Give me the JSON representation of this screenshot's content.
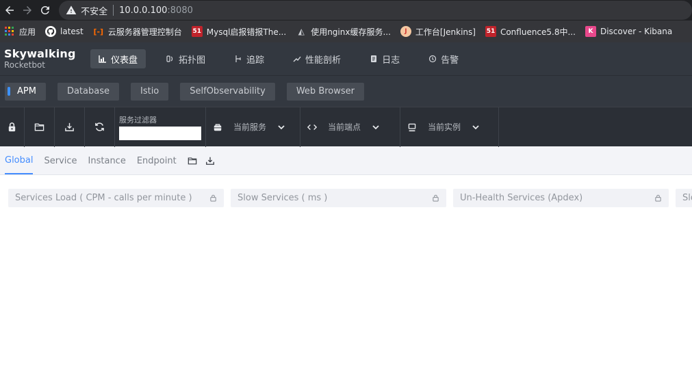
{
  "browser": {
    "insecure_label": "不安全",
    "host": "10.0.0.100",
    "port": ":8080"
  },
  "bookmarks": [
    {
      "label": "应用",
      "icon": "apps-grid-icon",
      "color": "#f28b82"
    },
    {
      "label": "latest",
      "icon": "github-icon",
      "color": "#ffffff"
    },
    {
      "label": "云服务器管理控制台",
      "icon": "aliyun-icon",
      "color": "#ff6a00"
    },
    {
      "label": "Mysql启报错报The...",
      "icon": "51cto-icon",
      "color": "#c0232b"
    },
    {
      "label": "使用nginx缓存服务...",
      "icon": "site-icon",
      "color": "#9aa0a6"
    },
    {
      "label": "工作台[Jenkins]",
      "icon": "jenkins-icon",
      "color": "#d33833"
    },
    {
      "label": "Confluence5.8中...",
      "icon": "51cto-icon",
      "color": "#c0232b"
    },
    {
      "label": "Discover - Kibana",
      "icon": "kibana-icon",
      "color": "#e8488b"
    }
  ],
  "header": {
    "logo_line1": "Skywalking",
    "logo_line2": "Rocketbot",
    "menu": [
      {
        "label": "仪表盘",
        "icon": "dashboard-icon",
        "active": true
      },
      {
        "label": "拓扑图",
        "icon": "topology-icon",
        "active": false
      },
      {
        "label": "追踪",
        "icon": "trace-icon",
        "active": false
      },
      {
        "label": "性能剖析",
        "icon": "profile-icon",
        "active": false
      },
      {
        "label": "日志",
        "icon": "log-icon",
        "active": false
      },
      {
        "label": "告警",
        "icon": "alarm-icon",
        "active": false
      }
    ]
  },
  "layers": [
    {
      "label": "APM",
      "active": true
    },
    {
      "label": "Database",
      "active": false
    },
    {
      "label": "Istio",
      "active": false
    },
    {
      "label": "SelfObservability",
      "active": false
    },
    {
      "label": "Web Browser",
      "active": false
    }
  ],
  "toolbar": {
    "filter_label": "服务过滤器",
    "filter_value": "",
    "current_service": "当前服务",
    "current_endpoint": "当前端点",
    "current_instance": "当前实例"
  },
  "tabs": [
    {
      "label": "Global",
      "active": true
    },
    {
      "label": "Service",
      "active": false
    },
    {
      "label": "Instance",
      "active": false
    },
    {
      "label": "Endpoint",
      "active": false
    }
  ],
  "cards": [
    {
      "title": "Services Load ( CPM - calls per minute )"
    },
    {
      "title": "Slow Services ( ms )"
    },
    {
      "title": "Un-Health Services (Apdex)"
    },
    {
      "title": "Slo"
    }
  ],
  "colors": {
    "accent": "#448dfe",
    "header_bg": "#333840",
    "toolbar_bg": "#2b2f36"
  }
}
